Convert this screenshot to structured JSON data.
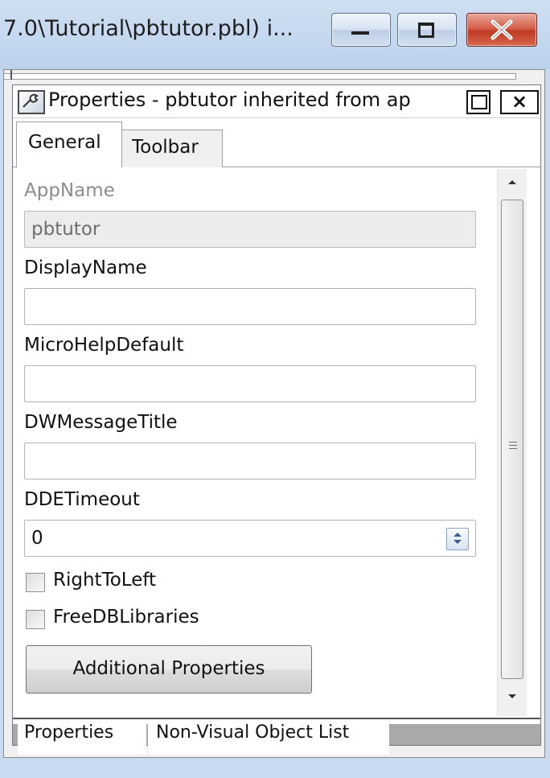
{
  "window": {
    "title": "7.0\\Tutorial\\pbtutor.pbl) i..."
  },
  "panel": {
    "title": "Properties - pbtutor inherited from ap",
    "close_glyph": "×",
    "tabs": [
      {
        "label": "General"
      },
      {
        "label": "Toolbar"
      }
    ]
  },
  "fields": {
    "appname_label": "AppName",
    "appname_value": "pbtutor",
    "displayname_label": "DisplayName",
    "displayname_value": "",
    "microhelp_label": "MicroHelpDefault",
    "microhelp_value": "",
    "dwmsg_label": "DWMessageTitle",
    "dwmsg_value": "",
    "ddetimeout_label": "DDETimeout",
    "ddetimeout_value": "0",
    "righttoleft_label": "RightToLeft",
    "righttoleft_checked": false,
    "freedb_label": "FreeDBLibraries",
    "freedb_checked": false,
    "additional_button": "Additional Properties"
  },
  "bottom_tabs": [
    {
      "label": "Properties"
    },
    {
      "label": "Non-Visual Object List"
    }
  ],
  "colors": {
    "close_button": "#c13a22",
    "titlebar": "#c9daf0"
  }
}
